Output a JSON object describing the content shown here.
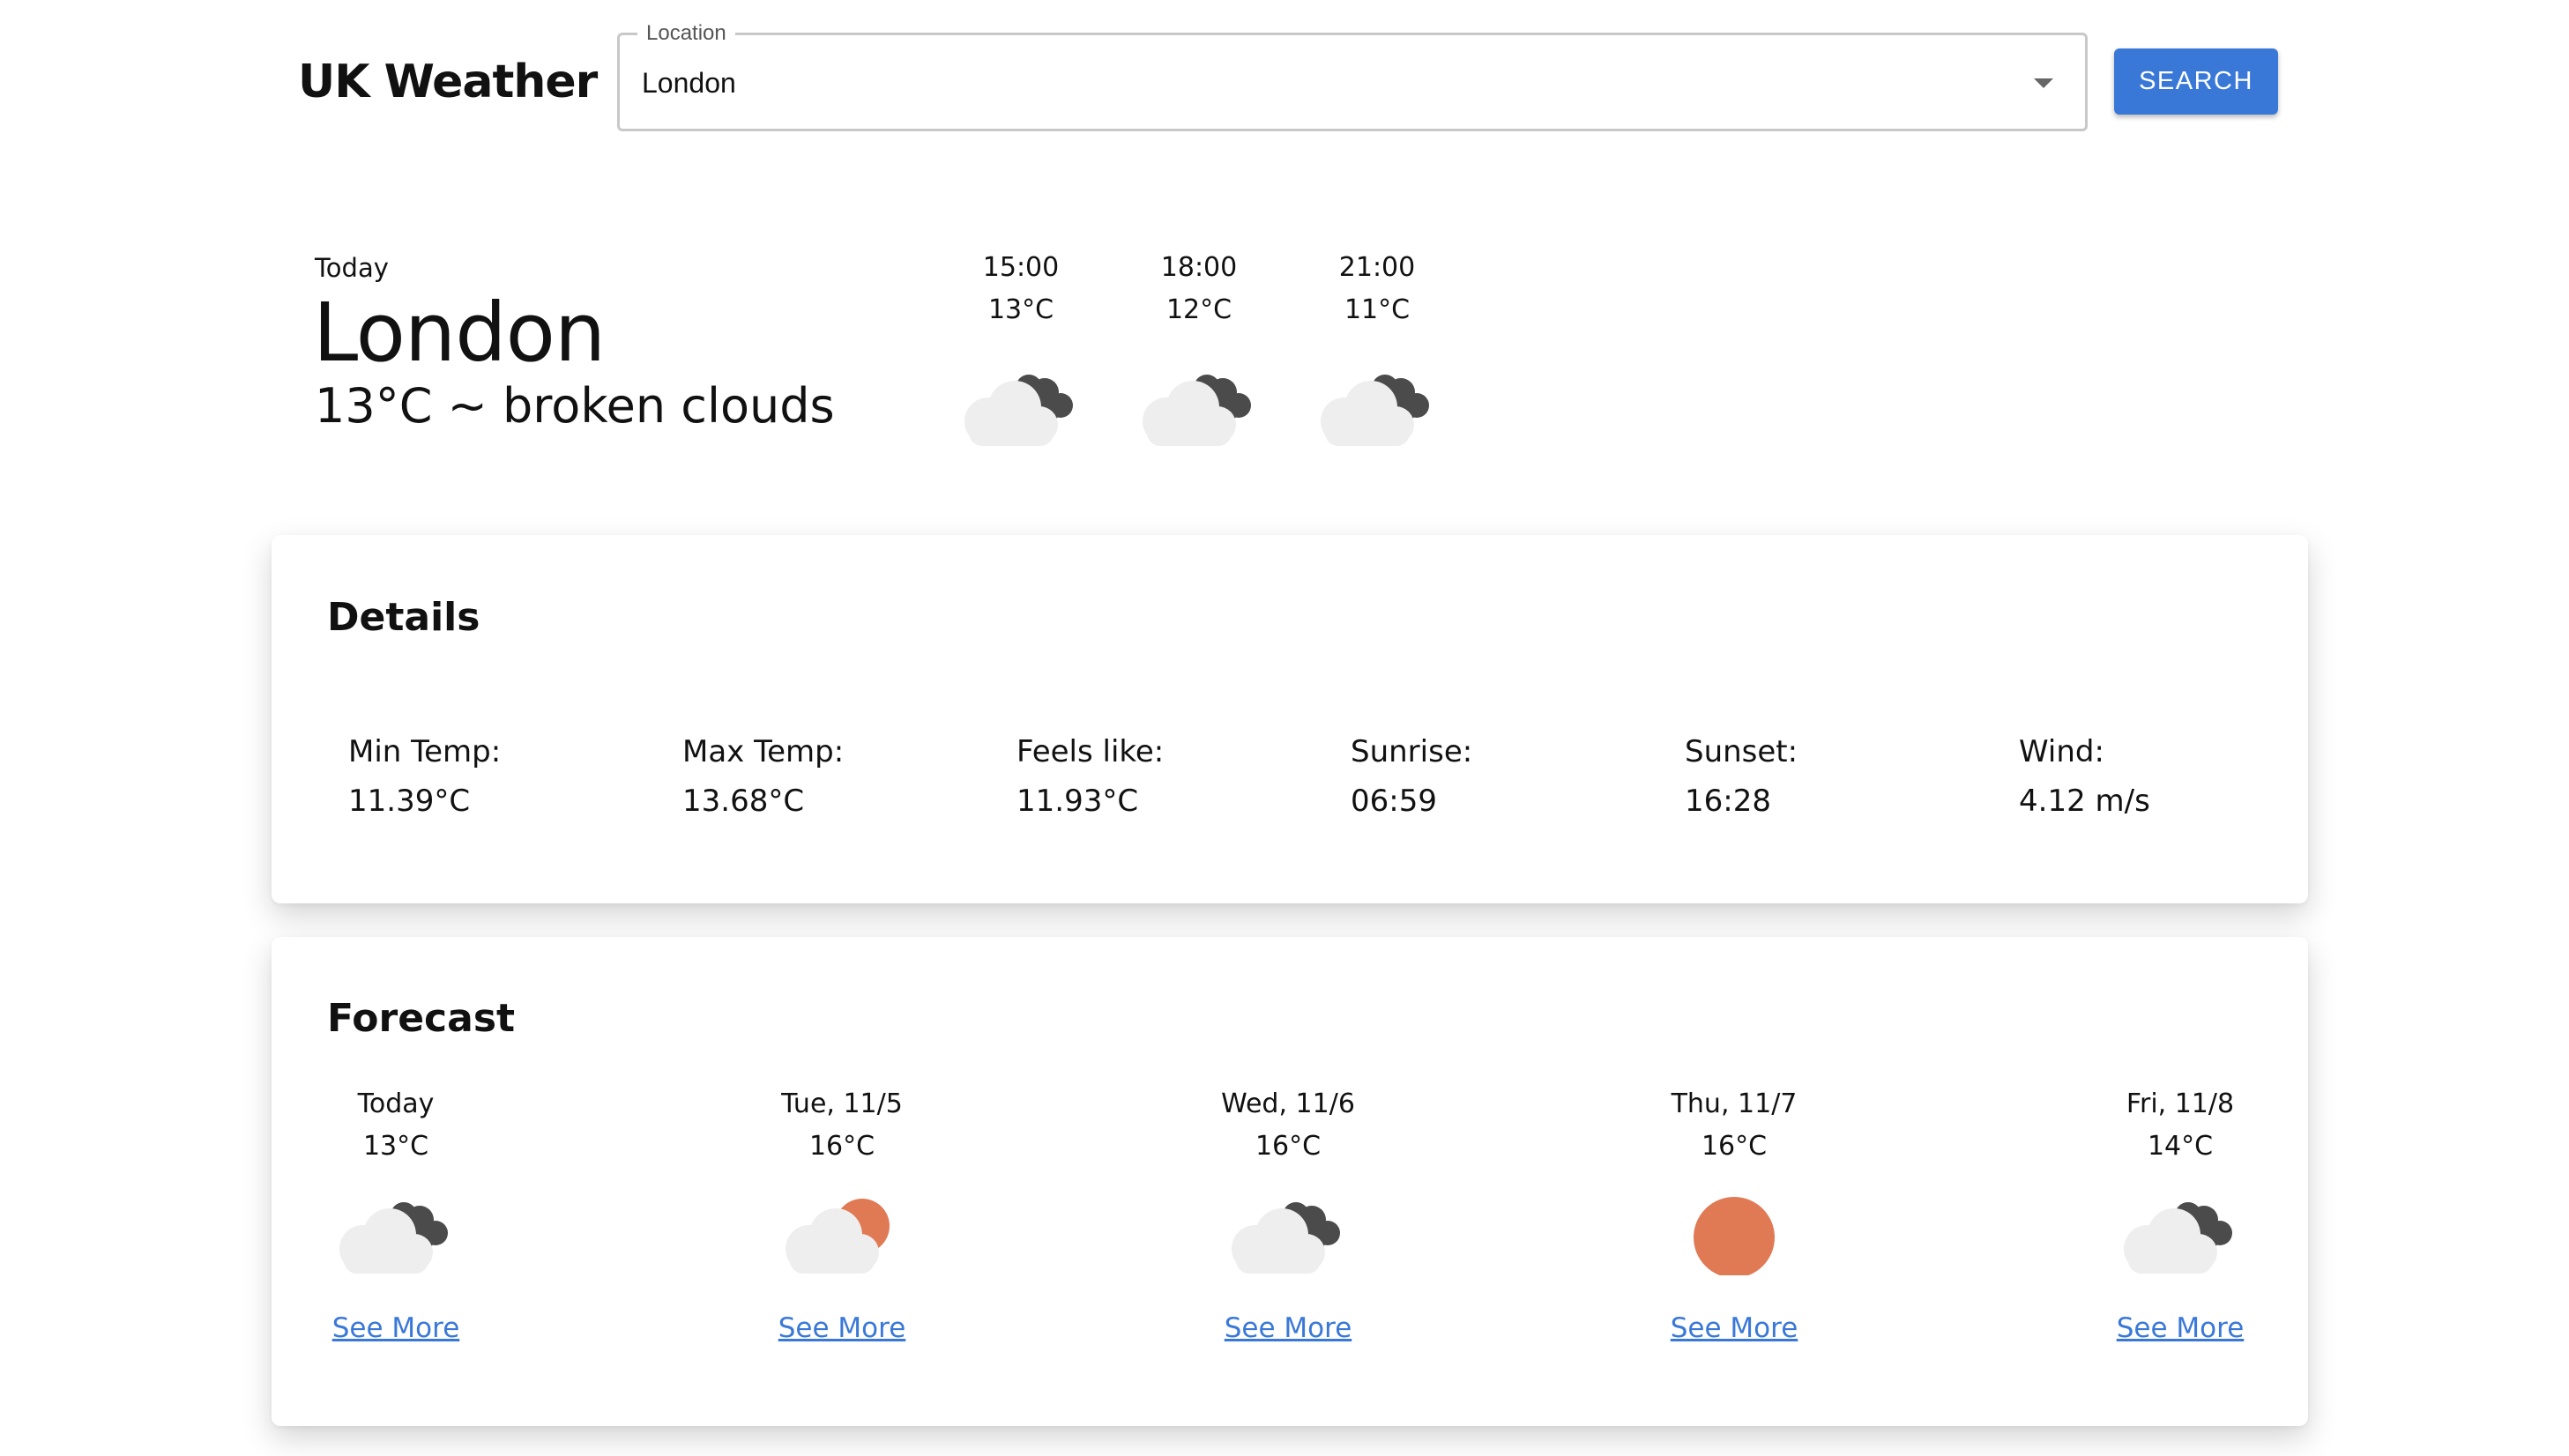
{
  "header": {
    "app_title": "UK Weather",
    "location_label": "Location",
    "location_value": "London",
    "search_label": "SEARCH"
  },
  "today": {
    "label": "Today",
    "city": "London",
    "summary": "13°C ~ broken clouds",
    "hourly": [
      {
        "time": "15:00",
        "temp": "13°C",
        "icon": "broken-clouds-icon"
      },
      {
        "time": "18:00",
        "temp": "12°C",
        "icon": "broken-clouds-icon"
      },
      {
        "time": "21:00",
        "temp": "11°C",
        "icon": "broken-clouds-icon"
      }
    ]
  },
  "details": {
    "title": "Details",
    "items": [
      {
        "label": "Min Temp:",
        "value": "11.39°C"
      },
      {
        "label": "Max Temp:",
        "value": "13.68°C"
      },
      {
        "label": "Feels like:",
        "value": "11.93°C"
      },
      {
        "label": "Sunrise:",
        "value": "06:59"
      },
      {
        "label": "Sunset:",
        "value": "16:28"
      },
      {
        "label": "Wind:",
        "value": "4.12 m/s"
      }
    ]
  },
  "forecast": {
    "title": "Forecast",
    "see_more_label": "See More",
    "days": [
      {
        "date": "Today",
        "temp": "13°C",
        "icon": "broken-clouds-icon"
      },
      {
        "date": "Tue, 11/5",
        "temp": "16°C",
        "icon": "sun-behind-cloud-icon"
      },
      {
        "date": "Wed, 11/6",
        "temp": "16°C",
        "icon": "broken-clouds-icon"
      },
      {
        "date": "Thu, 11/7",
        "temp": "16°C",
        "icon": "sun-icon"
      },
      {
        "date": "Fri, 11/8",
        "temp": "14°C",
        "icon": "broken-clouds-icon"
      }
    ]
  },
  "colors": {
    "accent": "#3a78d8",
    "sun": "#e07a55",
    "dark_cloud": "#4b4b4b",
    "light_cloud": "#eeeeee"
  }
}
